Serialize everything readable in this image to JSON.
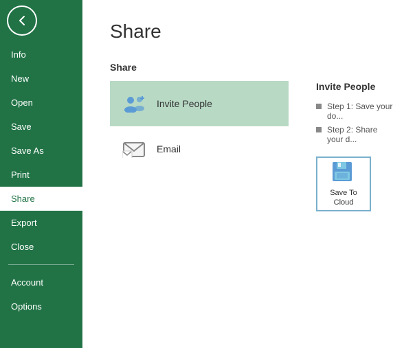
{
  "sidebar": {
    "items": [
      {
        "label": "Info",
        "id": "info",
        "active": false
      },
      {
        "label": "New",
        "id": "new",
        "active": false
      },
      {
        "label": "Open",
        "id": "open",
        "active": false
      },
      {
        "label": "Save",
        "id": "save",
        "active": false
      },
      {
        "label": "Save As",
        "id": "save-as",
        "active": false
      },
      {
        "label": "Print",
        "id": "print",
        "active": false
      },
      {
        "label": "Share",
        "id": "share",
        "active": true
      },
      {
        "label": "Export",
        "id": "export",
        "active": false
      },
      {
        "label": "Close",
        "id": "close",
        "active": false
      }
    ],
    "bottom_items": [
      {
        "label": "Account",
        "id": "account"
      },
      {
        "label": "Options",
        "id": "options"
      }
    ]
  },
  "page": {
    "title": "Share",
    "section_label": "Share"
  },
  "share_options": [
    {
      "label": "Invite People",
      "id": "invite-people",
      "selected": true
    },
    {
      "label": "Email",
      "id": "email",
      "selected": false
    }
  ],
  "invite_panel": {
    "title": "Invite People",
    "steps": [
      "Step 1: Save your do...",
      "Step 2: Share your d..."
    ],
    "save_to_cloud": {
      "label": "Save To\nCloud"
    }
  },
  "colors": {
    "sidebar_bg": "#217346",
    "selected_item_bg": "#b8d9c4",
    "accent_blue": "#5b9bd5"
  }
}
